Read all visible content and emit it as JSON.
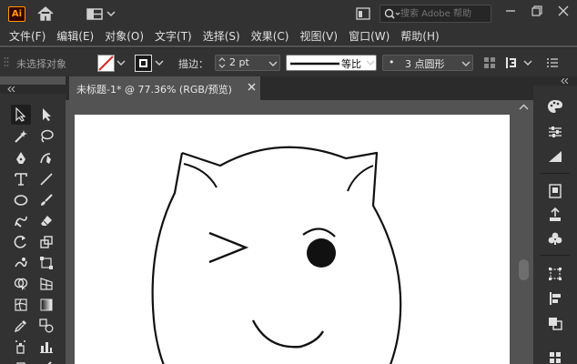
{
  "app": {
    "logo_text": "Ai",
    "search_placeholder": "搜索 Adobe 帮助",
    "window_controls": [
      "minimize-icon",
      "restore-icon",
      "close-icon"
    ]
  },
  "menu": [
    "文件(F)",
    "编辑(E)",
    "对象(O)",
    "文字(T)",
    "选择(S)",
    "效果(C)",
    "视图(V)",
    "窗口(W)",
    "帮助(H)"
  ],
  "control": {
    "no_selection": "未选择对象",
    "stroke_label": "描边：",
    "stroke_weight": "2 pt",
    "profile_label": "等比",
    "brush_label": "3 点圆形"
  },
  "document": {
    "tab_title": "未标题-1* @ 77.36% (RGB/预览)",
    "zoom": "77.36%",
    "color_mode": "RGB/预览"
  },
  "tools_left": [
    "selection-tool-icon",
    "direct-selection-tool-icon",
    "magic-wand-icon",
    "lasso-icon",
    "pen-tool-icon",
    "curvature-tool-icon",
    "type-tool-icon",
    "line-tool-icon",
    "ellipse-tool-icon",
    "paintbrush-icon",
    "shaper-tool-icon",
    "eraser-icon",
    "rotate-tool-icon",
    "scale-tool-icon",
    "warp-tool-icon",
    "free-transform-icon",
    "shape-builder-icon",
    "perspective-grid-icon",
    "mesh-tool-icon",
    "gradient-tool-icon",
    "eyedropper-icon",
    "blend-tool-icon",
    "symbol-sprayer-icon",
    "column-graph-icon",
    "artboard-tool-icon",
    "slice-tool-icon"
  ],
  "tools_right": [
    "color-palette-icon",
    "properties-sliders-icon",
    "gradient-panel-icon",
    "artboards-icon",
    "export-icon",
    "symbols-icon",
    "transform-icon",
    "align-icon",
    "pathfinder-icon",
    "swatches-grid-icon"
  ],
  "colors": {
    "chrome": "#323232",
    "canvas": "#535353",
    "artboard": "#ffffff",
    "accent_logo": "#ff9a00",
    "fill_none": "#d32b2b"
  }
}
